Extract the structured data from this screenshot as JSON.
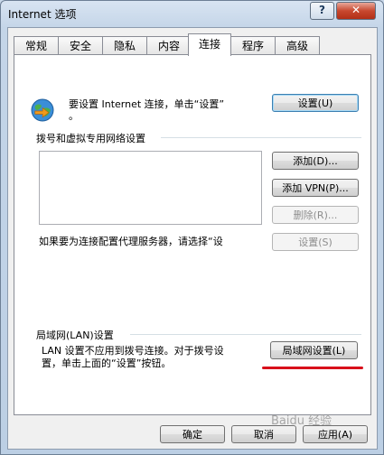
{
  "window": {
    "title": "Internet 选项",
    "help": "?",
    "close": "✕"
  },
  "tabs": [
    {
      "label": "常规",
      "active": false
    },
    {
      "label": "安全",
      "active": false
    },
    {
      "label": "隐私",
      "active": false
    },
    {
      "label": "内容",
      "active": false
    },
    {
      "label": "连接",
      "active": true
    },
    {
      "label": "程序",
      "active": false
    },
    {
      "label": "高级",
      "active": false
    }
  ],
  "setup": {
    "line1": "要设置 Internet 连接，单击“设置”",
    "line2": "。",
    "button": "设置(U)"
  },
  "dialup": {
    "heading": "拨号和虚拟专用网络设置",
    "add": "添加(D)...",
    "add_vpn": "添加 VPN(P)...",
    "remove": "删除(R)...",
    "proxy_text": "如果要为连接配置代理服务器，请选择“设",
    "settings": "设置(S)"
  },
  "lan": {
    "heading": "局域网(LAN)设置",
    "line1": "LAN 设置不应用到拨号连接。对于拨号设",
    "line2": "置，单击上面的“设置”按钮。",
    "button": "局域网设置(L)"
  },
  "footer": {
    "ok": "确定",
    "cancel": "取消",
    "apply": "应用(A)"
  },
  "watermark": "Baidu 经验",
  "colors": {
    "accent": "#d8101b",
    "focus": "#3c7fb1"
  }
}
